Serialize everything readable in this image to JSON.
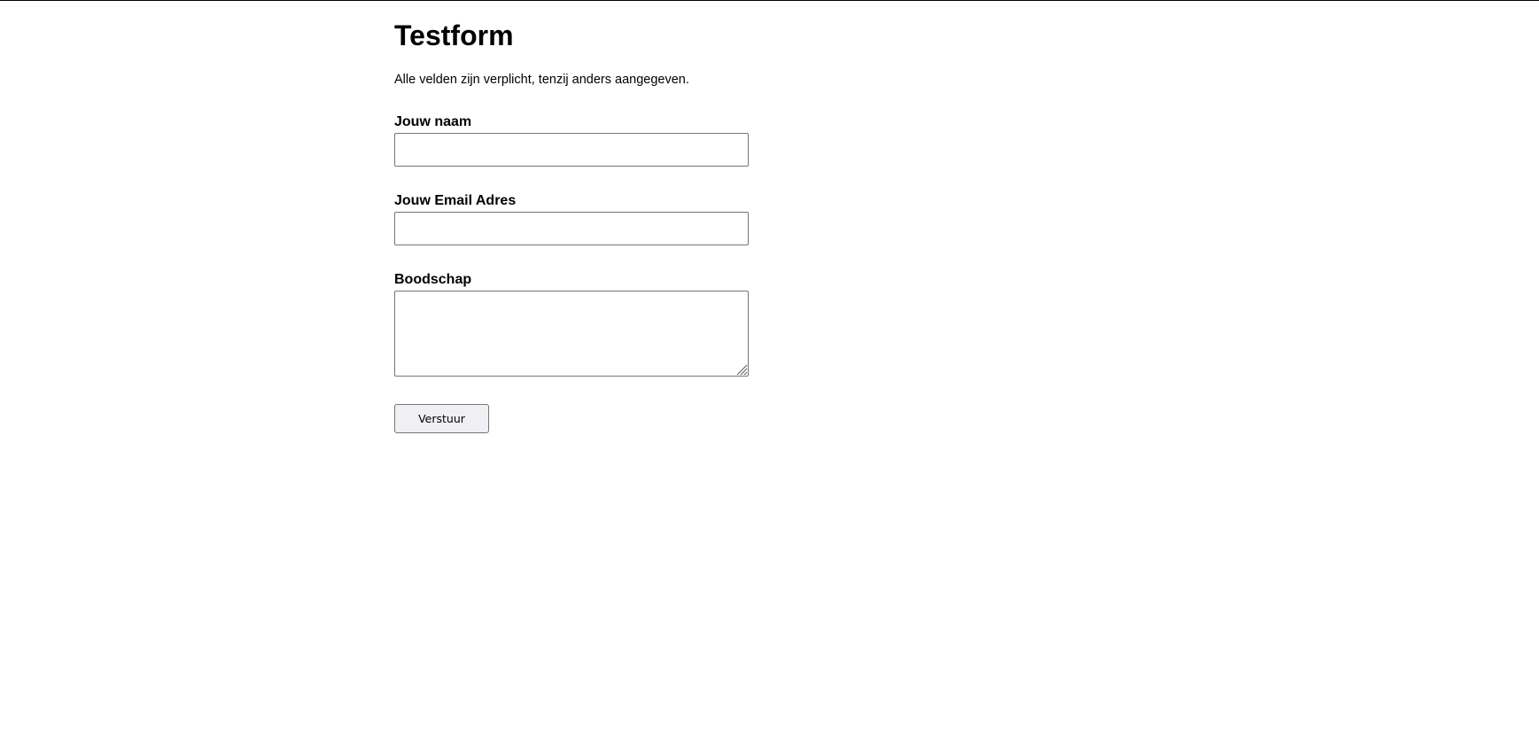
{
  "page": {
    "title": "Testform",
    "intro": "Alle velden zijn verplicht, tenzij anders aangegeven."
  },
  "form": {
    "name": {
      "label": "Jouw naam",
      "value": "",
      "placeholder": ""
    },
    "email": {
      "label": "Jouw Email Adres",
      "value": "",
      "placeholder": ""
    },
    "message": {
      "label": "Boodschap",
      "value": "",
      "placeholder": ""
    },
    "submit_label": "Verstuur"
  },
  "icons": {
    "resize": "resize-grip-icon"
  },
  "colors": {
    "text": "#000000",
    "background": "#ffffff",
    "field_border": "#767676",
    "button_background": "#efeff4"
  }
}
